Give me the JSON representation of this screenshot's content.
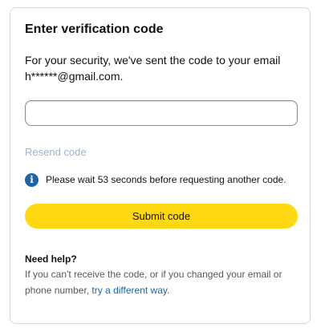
{
  "card": {
    "title": "Enter verification code",
    "description_line1": "For your security, we've sent the code to your email",
    "description_line2": "h******@gmail.com.",
    "code_input": {
      "value": "",
      "placeholder": ""
    },
    "resend_label": "Resend code",
    "info": {
      "icon": "info-icon",
      "icon_glyph": "i",
      "message": "Please wait 53 seconds before requesting another code."
    },
    "submit_label": "Submit code",
    "help": {
      "title": "Need help?",
      "text_before_link": "If you can't receive the code, or if you changed your email or phone number, ",
      "link_text": "try a different way",
      "text_after_link": "."
    }
  },
  "colors": {
    "button_yellow": "#ffd814",
    "link_blue": "#2162a1",
    "disabled_link": "#9ab3cf",
    "border": "#d5d9d9"
  }
}
